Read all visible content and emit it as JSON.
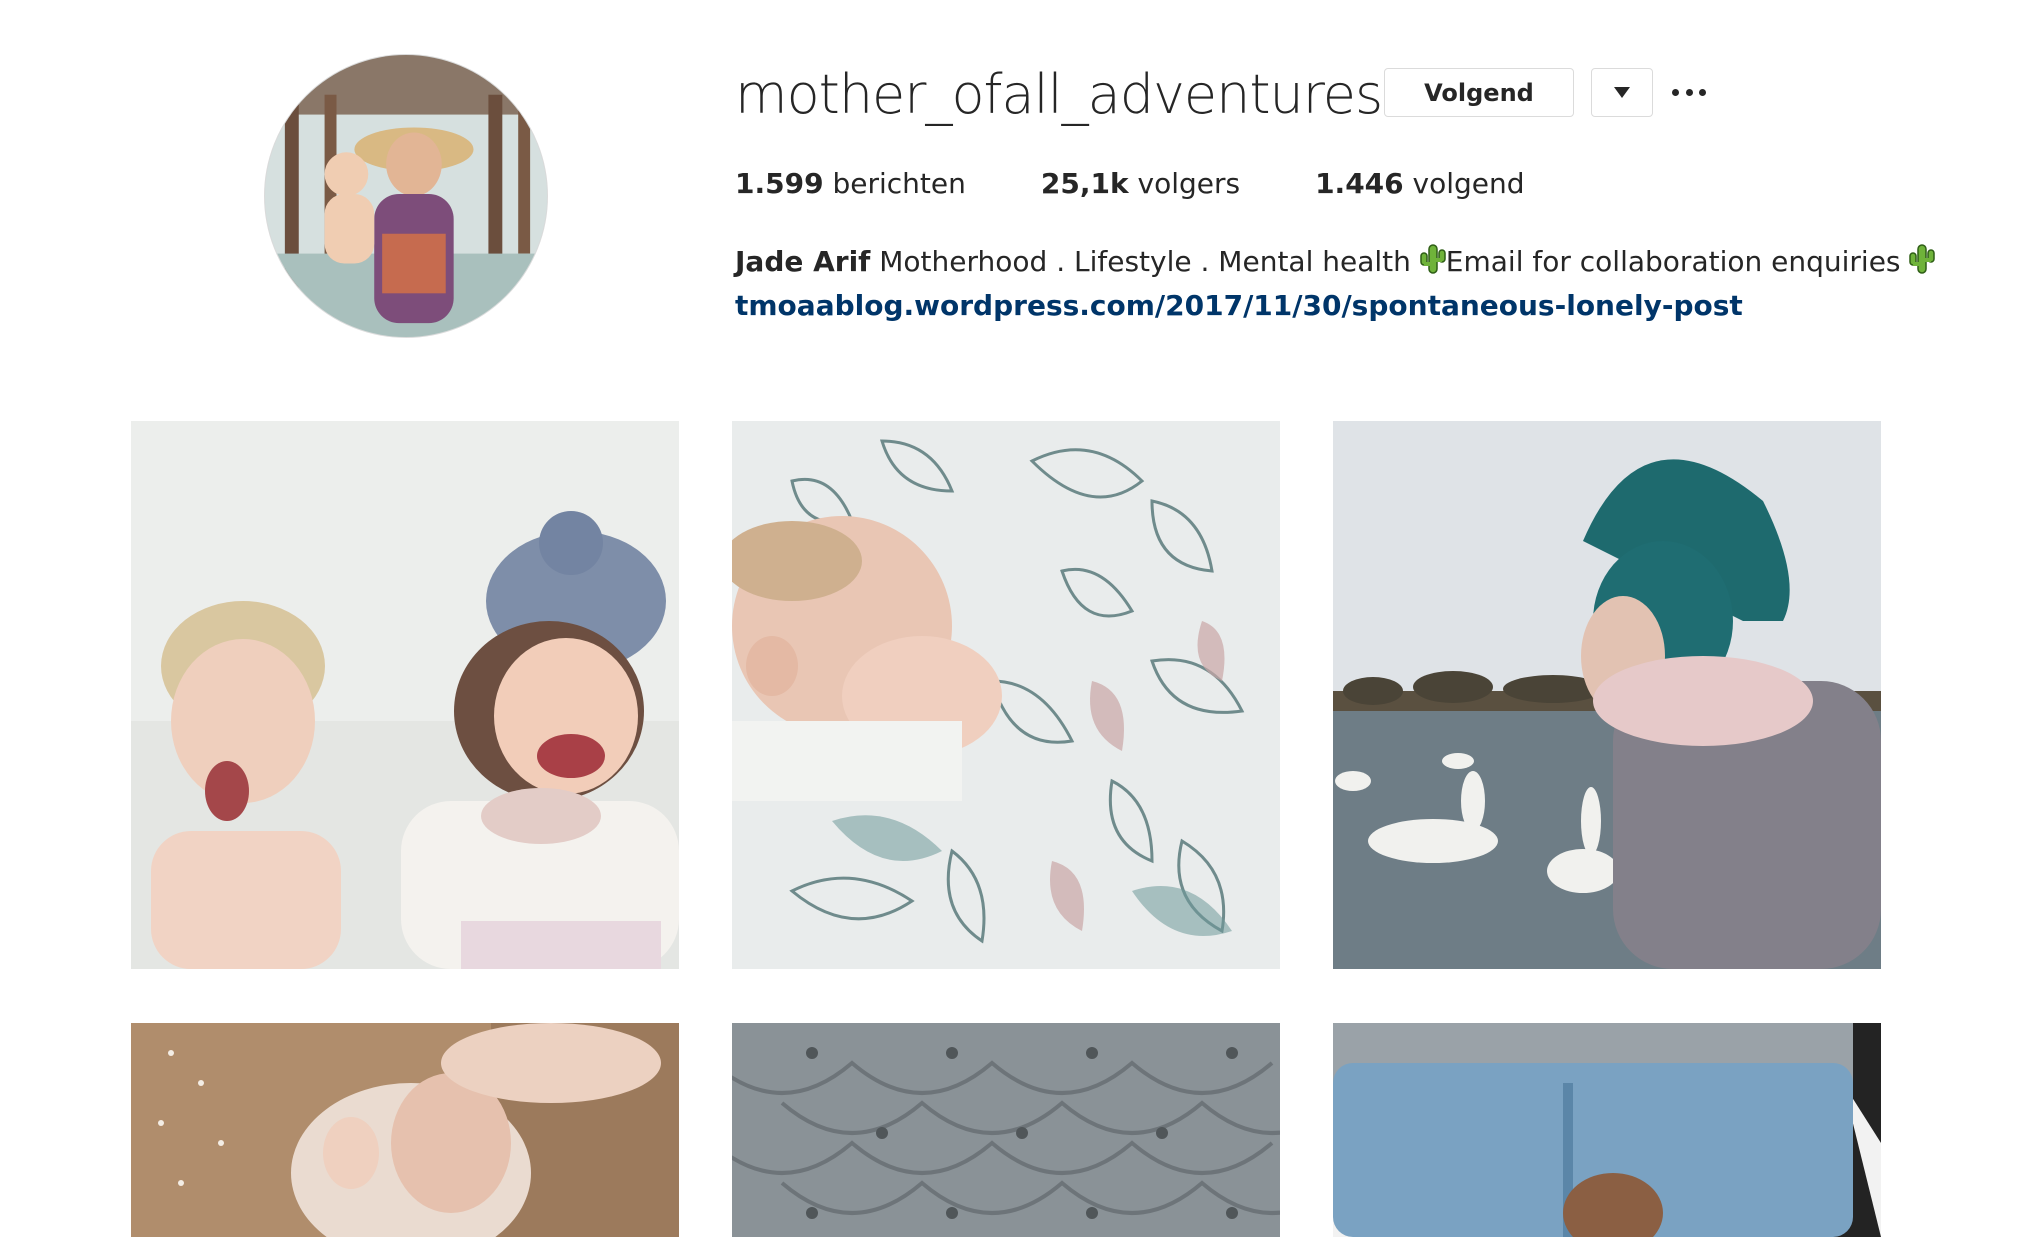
{
  "profile": {
    "username": "mother_ofall_adventures",
    "follow_label": "Volgend",
    "stats": {
      "posts_count": "1.599",
      "posts_label": " berichten",
      "followers_count": "25,1k",
      "followers_label": " volgers",
      "following_count": "1.446",
      "following_label": " volgend"
    },
    "bio": {
      "full_name": "Jade Arif",
      "text_1": " Motherhood . Lifestyle . Mental health ",
      "text_2": "Email for collaboration enquiries ",
      "link": "tmoaablog.wordpress.com/2017/11/30/spontaneous-lonely-post"
    }
  },
  "icons": {
    "dropdown": "chevron-down-icon",
    "more": "more-options-icon",
    "bio_emoji": "cactus-icon"
  },
  "colors": {
    "link": "#003569",
    "border": "#dbdbdb",
    "text": "#262626"
  }
}
